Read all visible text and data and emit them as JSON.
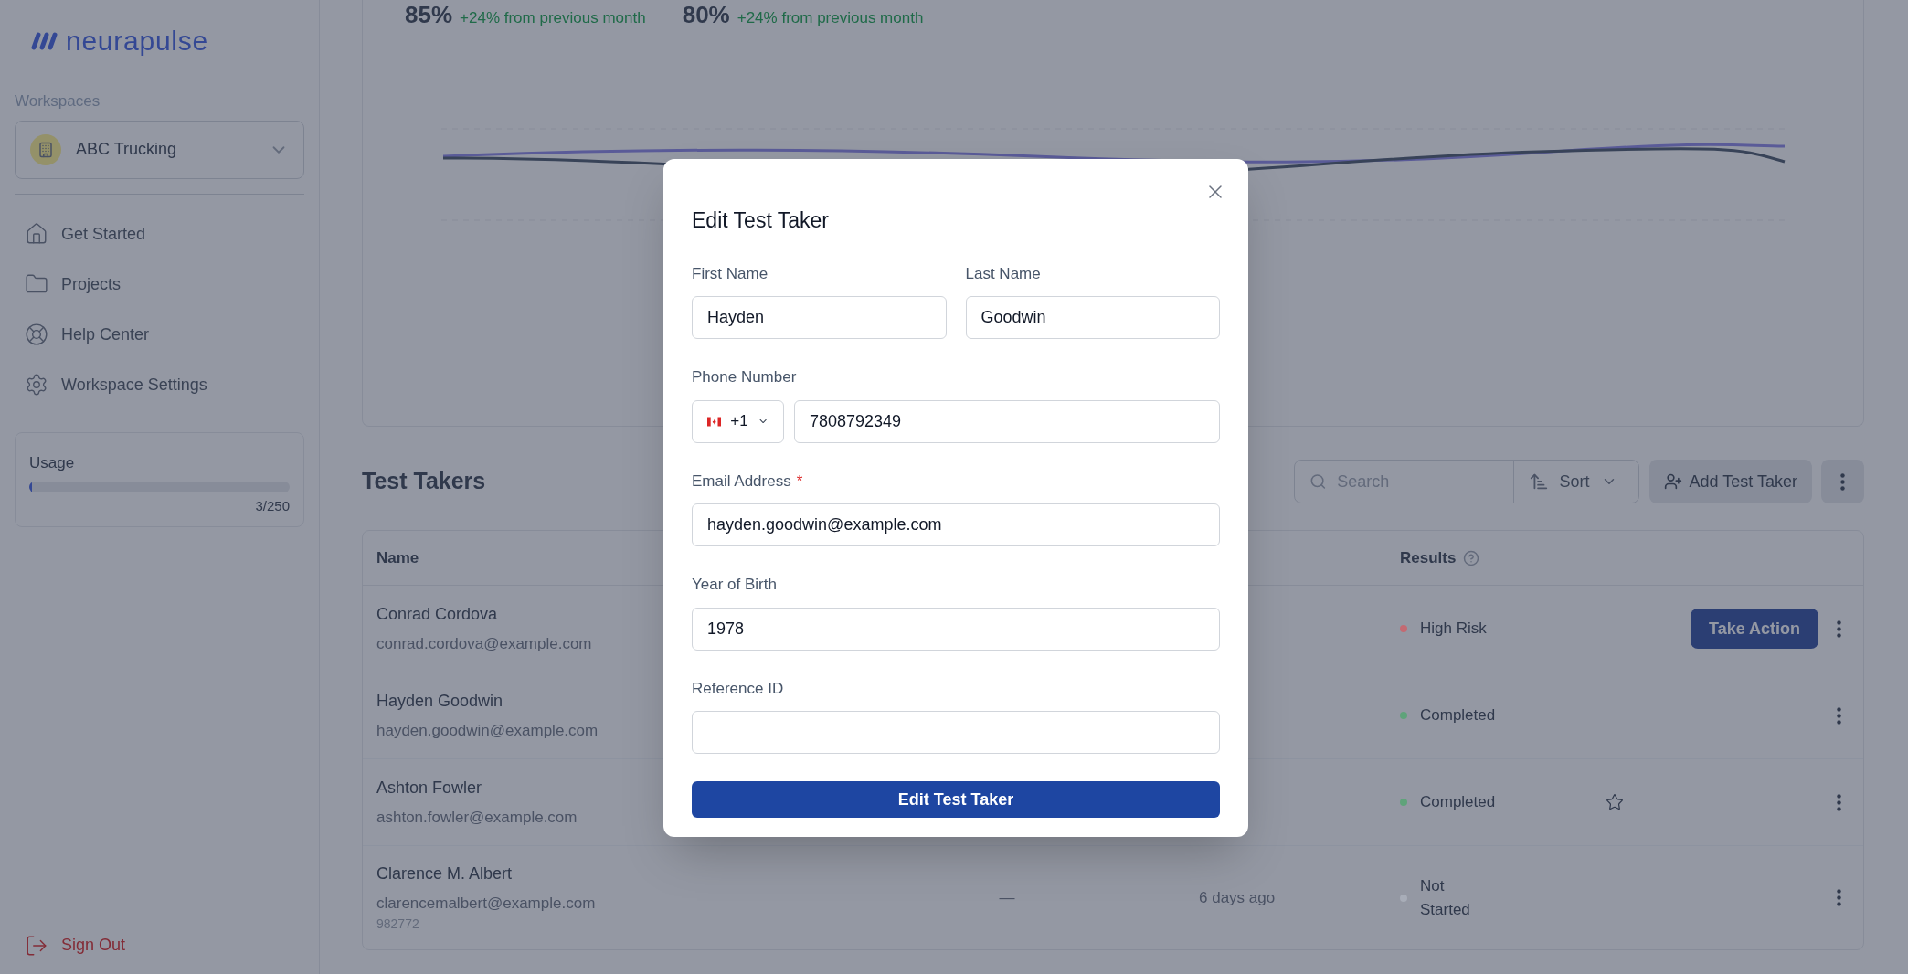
{
  "sidebar": {
    "logo": "neurapulse",
    "workspaces_label": "Workspaces",
    "workspace": "ABC Trucking",
    "nav": [
      {
        "label": "Get Started"
      },
      {
        "label": "Projects"
      },
      {
        "label": "Help Center"
      },
      {
        "label": "Workspace Settings"
      }
    ],
    "usage": {
      "label": "Usage",
      "level": 0.012,
      "reading": "3/250"
    },
    "sign_out": "Sign Out"
  },
  "stats": [
    {
      "value": "85%",
      "change": "+24% from previous month"
    },
    {
      "value": "80%",
      "change": "+24% from previous month"
    }
  ],
  "test_takers": {
    "title": "Test Takers",
    "search": {
      "placeholder": "Search"
    },
    "sort": "Sort",
    "add_button": "Add Test Taker",
    "columns": {
      "name": "Name",
      "results": "Results"
    },
    "rows": [
      {
        "name": "Conrad Cordova",
        "email": "conrad.cordova@example.com",
        "result": "High Risk",
        "color": "#c46a72",
        "action": "Take Action",
        "star": false
      },
      {
        "name": "Hayden Goodwin",
        "email": "hayden.goodwin@example.com",
        "result": "Completed",
        "color": "#5fa37a",
        "star": false
      },
      {
        "name": "Ashton Fowler",
        "email": "ashton.fowler@example.com",
        "result": "Completed",
        "color": "#5fa37a",
        "star": true
      },
      {
        "name": "Clarence M. Albert",
        "email": "clarencemalbert@example.com",
        "reference": "982772",
        "column_2": "—",
        "column_3": "6 days ago",
        "result": "Not Started",
        "color": "#a8adb8",
        "star": false
      }
    ]
  },
  "modal": {
    "title": "Edit Test Taker",
    "submit": "Edit Test Taker",
    "rows": [
      [
        {
          "kind": "text",
          "label": "First Name",
          "value": "Hayden"
        },
        {
          "kind": "text",
          "label": "Last Name",
          "value": "Goodwin"
        }
      ],
      [
        {
          "kind": "phone",
          "label": "Phone Number",
          "country_code": "+1",
          "value": "7808792349"
        }
      ],
      [
        {
          "kind": "text",
          "label": "Email Address",
          "value": "hayden.goodwin@example.com",
          "required_mark": "*"
        }
      ],
      [
        {
          "kind": "text",
          "label": "Year of Birth",
          "value": "1978"
        }
      ],
      [
        {
          "kind": "text",
          "label": "Reference ID"
        }
      ]
    ]
  }
}
